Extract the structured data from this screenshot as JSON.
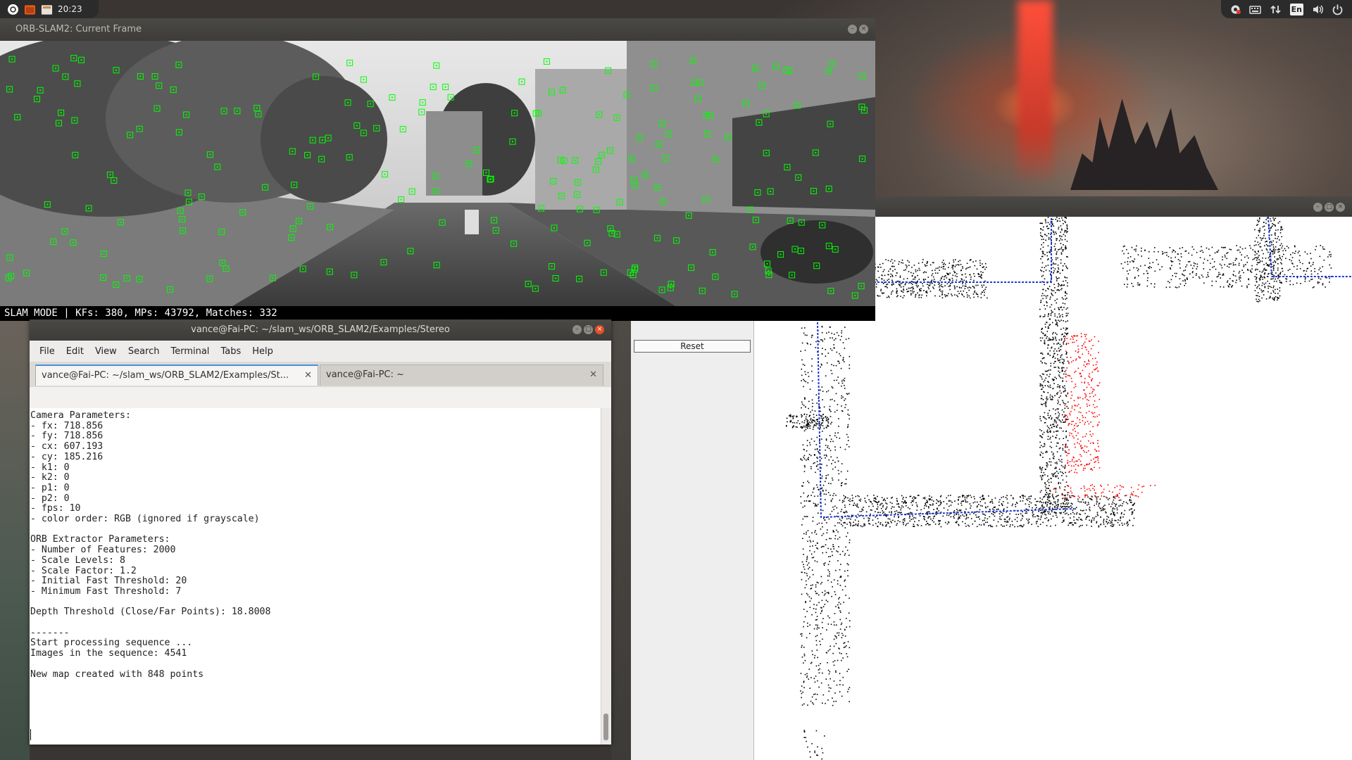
{
  "panel": {
    "clock": "20:23",
    "lang": "En",
    "left_icons": [
      "ubuntu-logo-icon",
      "terminal-app-icon",
      "files-app-icon"
    ],
    "right_icons": [
      "settings-icon",
      "keyboard-icon",
      "network-icon",
      "language-icon",
      "volume-icon",
      "power-icon"
    ]
  },
  "frame_window": {
    "title": "ORB-SLAM2: Current Frame",
    "status": "SLAM MODE |  KFs: 380, MPs: 43792, Matches: 332",
    "keypoint_color": "#00ff00"
  },
  "map_viewer": {
    "reset_label": "Reset",
    "trajectory_color": "#1f3ad6",
    "local_map_color": "#ff0000",
    "map_point_color": "#000000"
  },
  "terminal": {
    "title": "vance@Fai-PC: ~/slam_ws/ORB_SLAM2/Examples/Stereo",
    "menu": [
      "File",
      "Edit",
      "View",
      "Search",
      "Terminal",
      "Tabs",
      "Help"
    ],
    "tabs": [
      {
        "label": "vance@Fai-PC: ~/slam_ws/ORB_SLAM2/Examples/St...",
        "close": "✕"
      },
      {
        "label": "vance@Fai-PC: ~",
        "close": "✕"
      }
    ],
    "lines": [
      "Camera Parameters:",
      "- fx: 718.856",
      "- fy: 718.856",
      "- cx: 607.193",
      "- cy: 185.216",
      "- k1: 0",
      "- k2: 0",
      "- p1: 0",
      "- p2: 0",
      "- fps: 10",
      "- color order: RGB (ignored if grayscale)",
      "",
      "ORB Extractor Parameters:",
      "- Number of Features: 2000",
      "- Scale Levels: 8",
      "- Scale Factor: 1.2",
      "- Initial Fast Threshold: 20",
      "- Minimum Fast Threshold: 7",
      "",
      "Depth Threshold (Close/Far Points): 18.8008",
      "",
      "-------",
      "Start processing sequence ...",
      "Images in the sequence: 4541",
      "",
      "New map created with 848 points"
    ]
  }
}
